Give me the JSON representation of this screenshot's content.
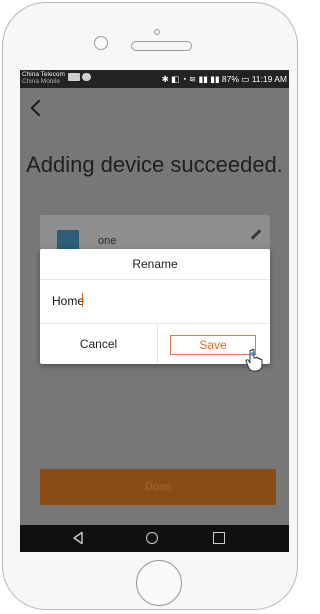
{
  "status_bar": {
    "carrier": "China Telecom",
    "carrier_sub": "China Mobile",
    "battery": "87%",
    "time": "11:19 AM"
  },
  "page": {
    "title": "Adding device succeeded.",
    "device_name": "one",
    "done_label": "Done"
  },
  "dialog": {
    "title": "Rename",
    "input_value": "Home",
    "cancel_label": "Cancel",
    "save_label": "Save"
  },
  "colors": {
    "accent": "#e86a1a",
    "overlay": "#777777",
    "done_button": "#8a4c16"
  },
  "icons": {
    "back": "back-chevron-icon",
    "edit": "pencil-icon",
    "cursor": "hand-pointer-icon",
    "nav_back": "triangle-back-icon",
    "nav_home": "circle-home-icon",
    "nav_recent": "square-recent-icon"
  }
}
